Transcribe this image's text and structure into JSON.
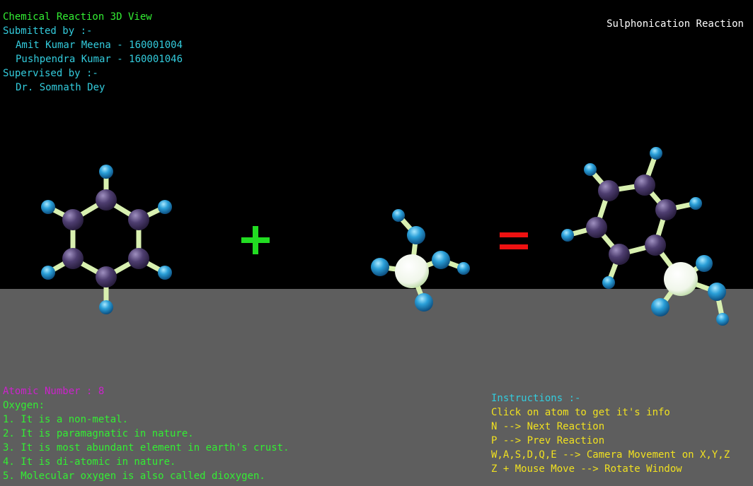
{
  "header": {
    "title": "Chemical Reaction 3D View",
    "submitted_label": "Submitted by :-",
    "authors": [
      "Amit Kumar Meena - 160001004",
      "Pushpendra Kumar - 160001046"
    ],
    "supervised_label": "Supervised by :-",
    "supervisor": "Dr. Somnath Dey"
  },
  "reaction": {
    "name": "Sulphonication Reaction"
  },
  "atom_info": {
    "atomic_number": "Atomic Number : 8",
    "element": "Oxygen:",
    "facts": [
      "1. It is a non-metal.",
      "2. It is paramagnatic in nature.",
      "3. It is most abundant element in earth's crust.",
      "4. It is di-atomic in nature.",
      "5. Molecular oxygen is also called dioxygen."
    ]
  },
  "instructions": {
    "heading": "Instructions :-",
    "lines": [
      "Click on atom to get it's info",
      "N --> Next Reaction",
      "P --> Prev Reaction",
      "W,A,S,D,Q,E --> Camera Movement on X,Y,Z",
      "Z + Mouse Move --> Rotate Window"
    ]
  },
  "colors": {
    "background": "#000000",
    "floor": "#5e5e5e",
    "bond": "#d8f0b0",
    "carbon": "#5a4a7a",
    "hydrogen": "#3aaee0",
    "sulfur": "#ffffff",
    "plus": "#22dd22",
    "equals": "#ee1111"
  },
  "icons": {
    "plus": "plus-icon",
    "equals": "equals-icon"
  }
}
